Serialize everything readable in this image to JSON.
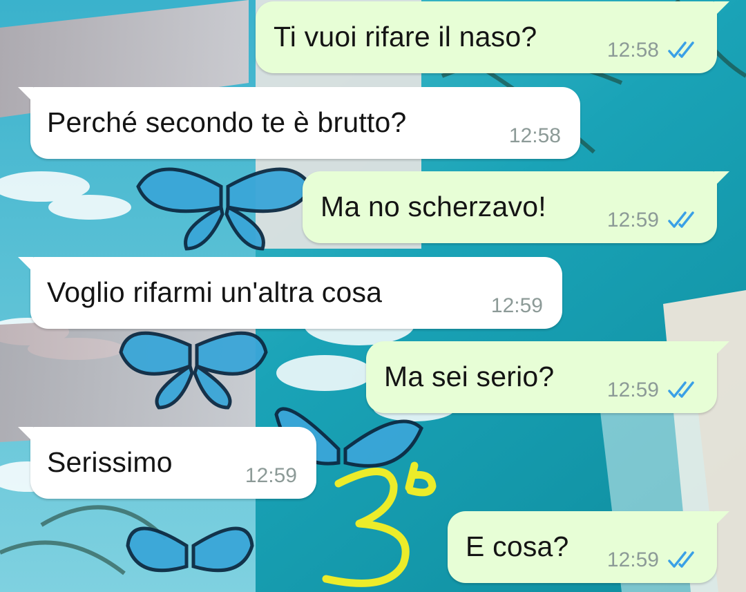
{
  "chat": {
    "messages": [
      {
        "direction": "outgoing",
        "text": "Ti vuoi rifare il naso?",
        "time": "12:58",
        "status": "read-double-check"
      },
      {
        "direction": "incoming",
        "text": "Perché secondo te è brutto?",
        "time": "12:58"
      },
      {
        "direction": "outgoing",
        "text": "Ma no scherzavo!",
        "time": "12:59",
        "status": "read-double-check"
      },
      {
        "direction": "incoming",
        "text": "Voglio rifarmi un'altra cosa",
        "time": "12:59"
      },
      {
        "direction": "outgoing",
        "text": "Ma sei serio?",
        "time": "12:59",
        "status": "read-double-check"
      },
      {
        "direction": "incoming",
        "text": "Serissimo",
        "time": "12:59"
      },
      {
        "direction": "outgoing",
        "text": "E cosa?",
        "time": "12:59",
        "status": "read-double-check"
      }
    ]
  },
  "overlay": {
    "handwriting": "3b",
    "color": "#ecec2a"
  },
  "colors": {
    "outgoing_bubble": "#e7fed6",
    "incoming_bubble": "#ffffff",
    "read_tick": "#3aa0e6",
    "timestamp": "#8c9a97"
  },
  "wallpaper": {
    "icons": [
      "butterfly-icon",
      "airplane-wing",
      "palm-leaf",
      "ocean-waves",
      "clouds"
    ]
  }
}
